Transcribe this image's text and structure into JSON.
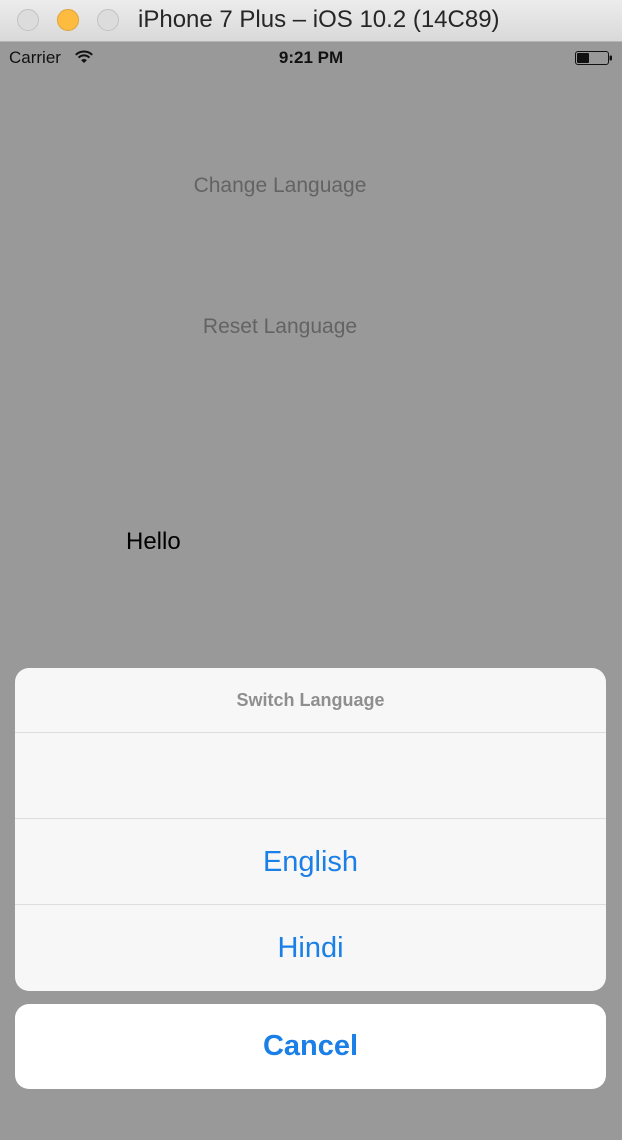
{
  "window": {
    "title": "iPhone 7 Plus – iOS 10.2 (14C89)"
  },
  "statusbar": {
    "carrier": "Carrier",
    "time": "9:21 PM",
    "icons": [
      "wifi-icon",
      "battery-icon"
    ]
  },
  "main": {
    "change_language_label": "Change Language",
    "reset_language_label": "Reset Language",
    "hello_text": "Hello"
  },
  "action_sheet": {
    "title": "Switch Language",
    "options": [
      {
        "label": ""
      },
      {
        "label": "English"
      },
      {
        "label": "Hindi"
      }
    ],
    "cancel_label": "Cancel"
  },
  "colors": {
    "accent": "#1a7fe6",
    "dim_overlay": "#999999",
    "minimize_button": "#fdbc40"
  }
}
